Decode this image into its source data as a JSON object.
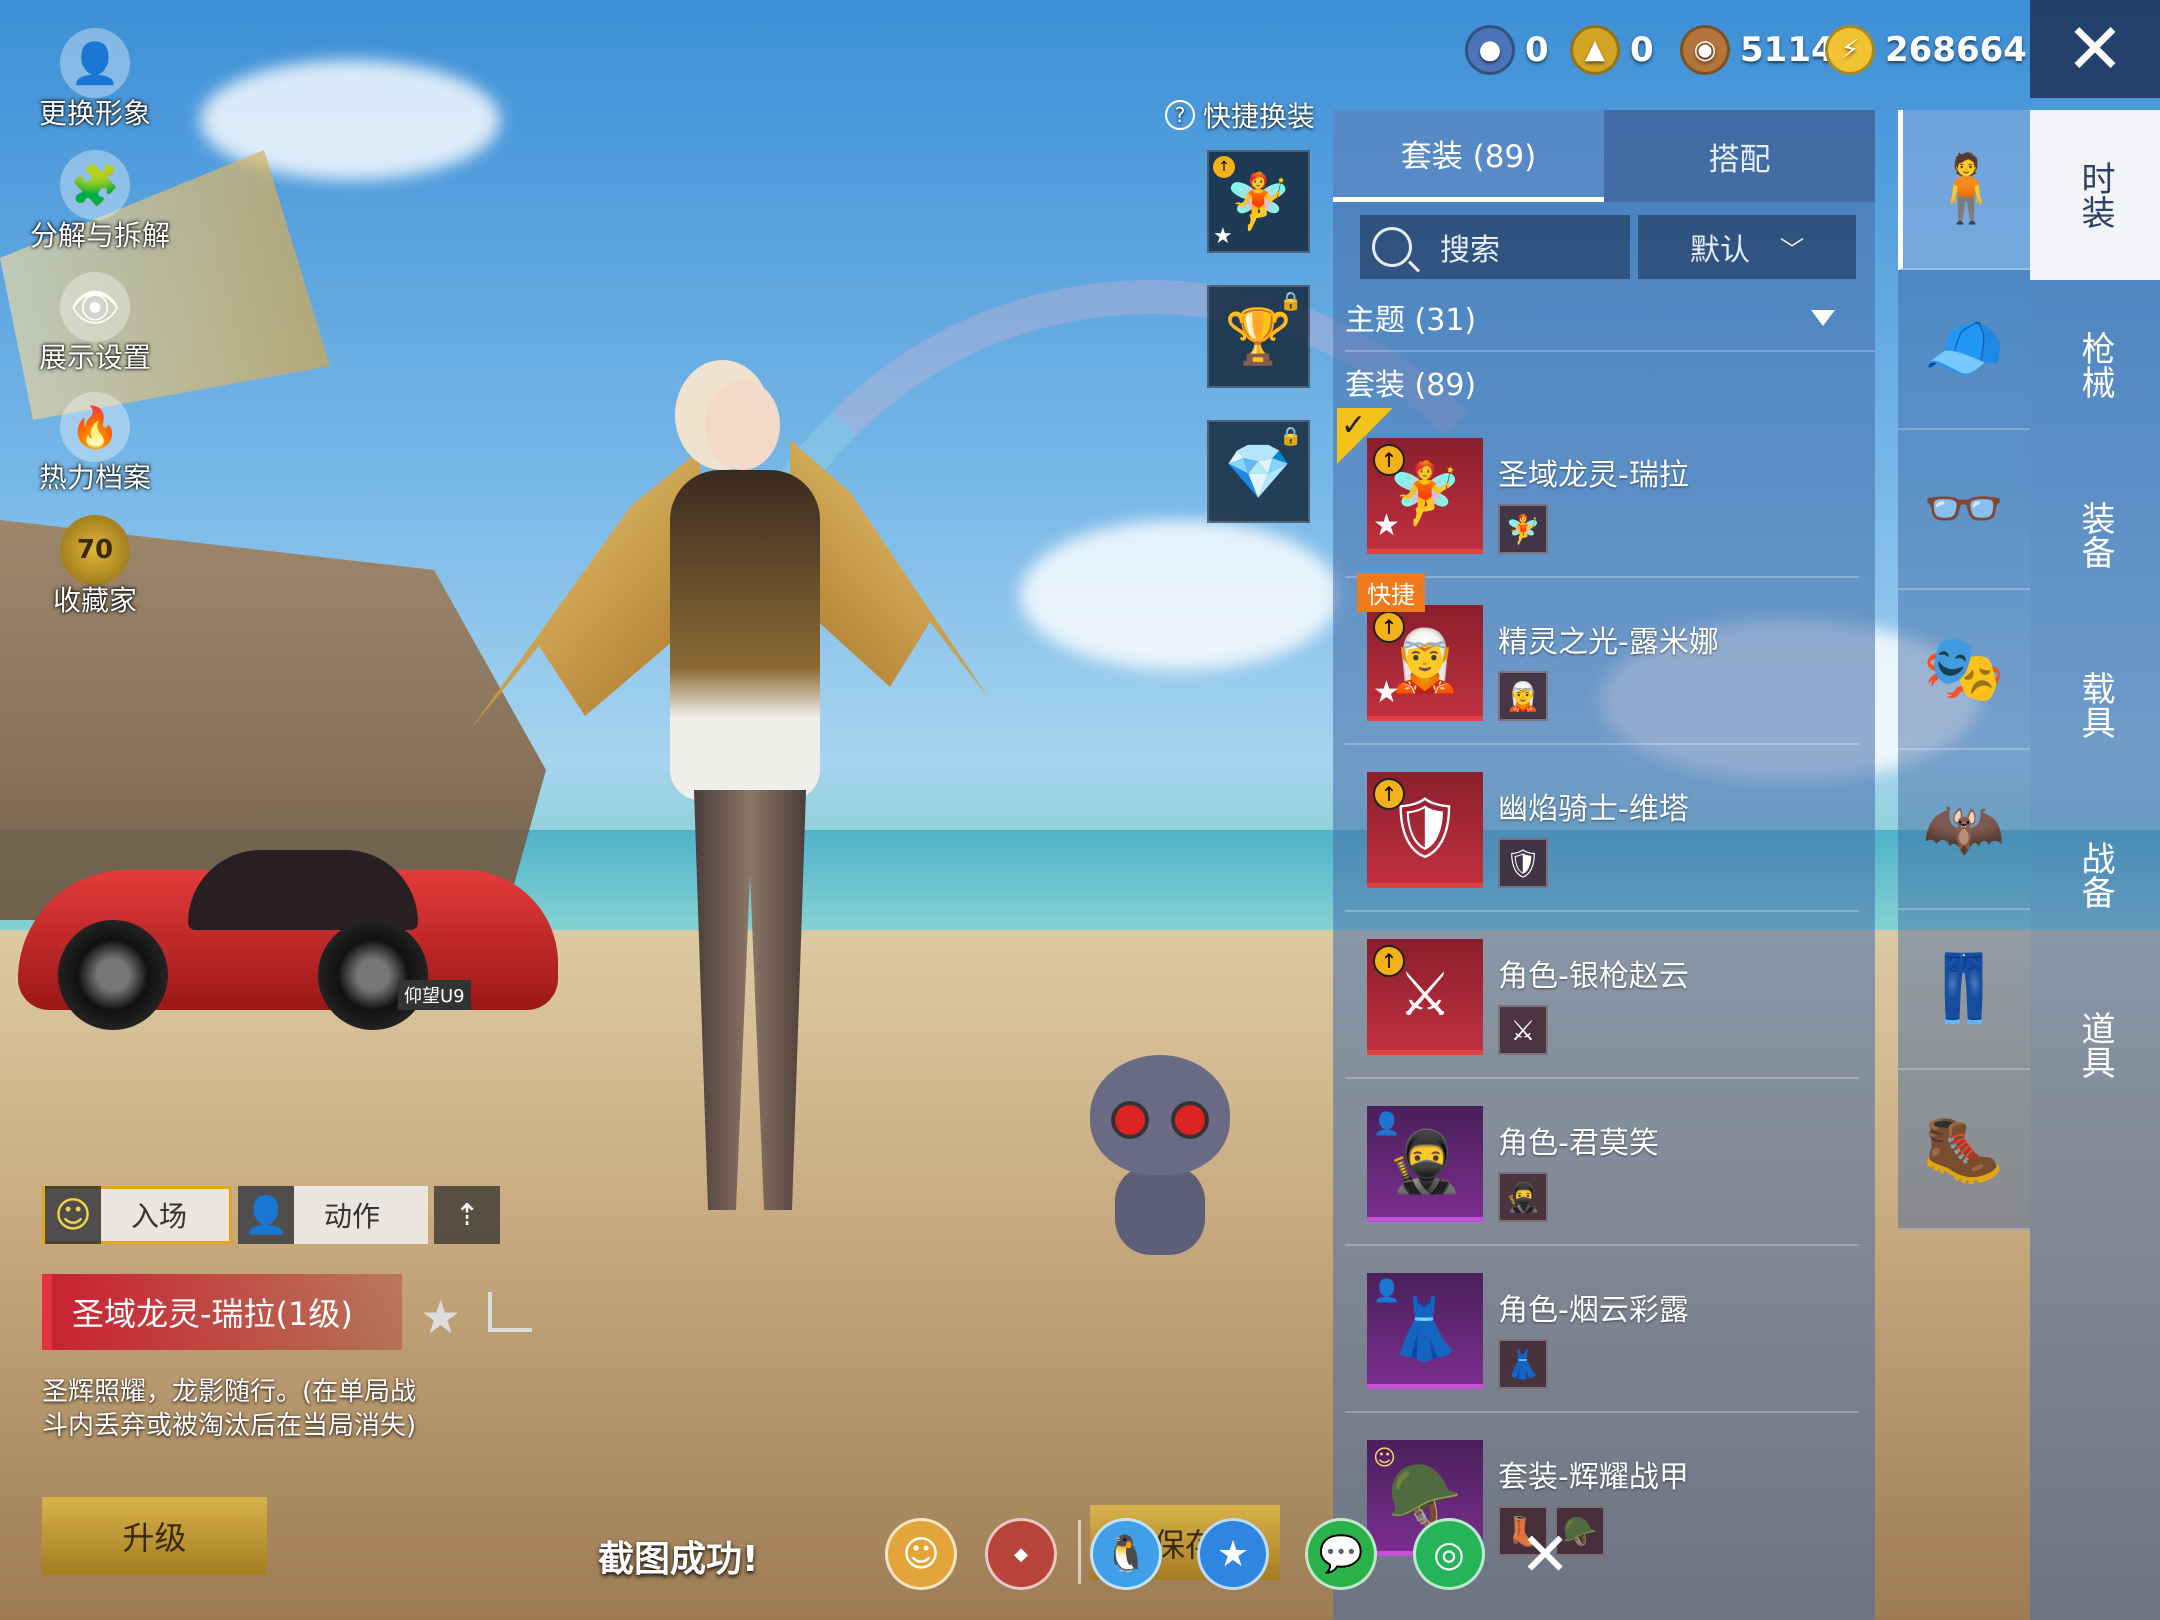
{
  "currencies": [
    {
      "icon": "medal-coin-icon",
      "value": "0",
      "color": "#4c74b8"
    },
    {
      "icon": "crest-coin-icon",
      "value": "0",
      "color": "#d2a426"
    },
    {
      "icon": "bronze-coin-icon",
      "value": "5114",
      "color": "#b3753a"
    },
    {
      "icon": "lightning-coin-icon",
      "value": "268664",
      "color": "#f1c332"
    }
  ],
  "left_menu": [
    {
      "label": "更换形象",
      "icon": "avatar-icon"
    },
    {
      "label": "分解与拆解",
      "icon": "puzzle-icon"
    },
    {
      "label": "展示设置",
      "icon": "eye-icon"
    },
    {
      "label": "热力档案",
      "icon": "flame-icon"
    },
    {
      "label": "收藏家",
      "icon": "collector-badge-icon",
      "badge": "70"
    }
  ],
  "quick_change": {
    "label": "快捷换装",
    "slots": [
      {
        "icon": "outfit-icon",
        "locked": false
      },
      {
        "icon": "trophy-icon",
        "locked": true
      },
      {
        "icon": "diamond-icon",
        "locked": true
      }
    ]
  },
  "panel": {
    "tabs": [
      "套装 (89)",
      "搭配"
    ],
    "search_label": "搜索",
    "sort_label": "默认",
    "theme_header": "主题 (31)",
    "suit_header": "套装 (89)",
    "items": [
      {
        "name": "圣域龙灵-瑞拉",
        "rarity": "red",
        "badge": "up",
        "star": true,
        "checked": true,
        "quick": false,
        "glyph": "🧚"
      },
      {
        "name": "精灵之光-露米娜",
        "rarity": "red",
        "badge": "up",
        "star": true,
        "checked": false,
        "quick": true,
        "quick_label": "快捷",
        "glyph": "🧝"
      },
      {
        "name": "幽焰骑士-维塔",
        "rarity": "red",
        "badge": "up",
        "star": false,
        "checked": false,
        "quick": false,
        "glyph": "🛡"
      },
      {
        "name": "角色-银枪赵云",
        "rarity": "red",
        "badge": "up",
        "star": false,
        "checked": false,
        "quick": false,
        "glyph": "⚔"
      },
      {
        "name": "角色-君莫笑",
        "rarity": "purple",
        "badge": "person",
        "star": false,
        "checked": false,
        "quick": false,
        "glyph": "🥷"
      },
      {
        "name": "角色-烟云彩露",
        "rarity": "purple",
        "badge": "person",
        "star": false,
        "checked": false,
        "quick": false,
        "glyph": "👗"
      },
      {
        "name": "套装-辉耀战甲",
        "rarity": "purple",
        "badge": "face",
        "star": false,
        "checked": false,
        "quick": false,
        "glyph": "🪖"
      }
    ]
  },
  "categories": [
    {
      "icon": "outfit-category-icon",
      "glyph": "🧍"
    },
    {
      "icon": "cap-icon",
      "glyph": "🧢"
    },
    {
      "icon": "glasses-icon",
      "glyph": "👓"
    },
    {
      "icon": "mask-icon",
      "glyph": "🎭"
    },
    {
      "icon": "winged-outfit-icon",
      "glyph": "🦇"
    },
    {
      "icon": "pants-icon",
      "glyph": "👖"
    },
    {
      "icon": "boots-icon",
      "glyph": "🥾"
    }
  ],
  "main_tabs": [
    "时装",
    "枪械",
    "装备",
    "载具",
    "战备",
    "道具"
  ],
  "actions": {
    "entrance": "入场",
    "motion": "动作"
  },
  "selected": {
    "name": "圣域龙灵-瑞拉(1级)",
    "description": "圣辉照耀，龙影随行。(在单局战斗内丢弃或被淘汰后在当局消失)",
    "upgrade_label": "升级"
  },
  "car_plate": "仰望U9",
  "screenshot": {
    "toast": "截图成功!",
    "save_label": "保存",
    "share_targets": [
      {
        "icon": "friend-icon",
        "color": "#e3a53a"
      },
      {
        "icon": "game-for-peace-icon",
        "color": "#b8433a"
      },
      {
        "icon": "qq-icon",
        "color": "#3fa0e8"
      },
      {
        "icon": "qzone-icon",
        "color": "#2f86e0"
      },
      {
        "icon": "wechat-icon",
        "color": "#2bb14a"
      },
      {
        "icon": "moments-icon",
        "color": "#26b45a"
      }
    ]
  }
}
